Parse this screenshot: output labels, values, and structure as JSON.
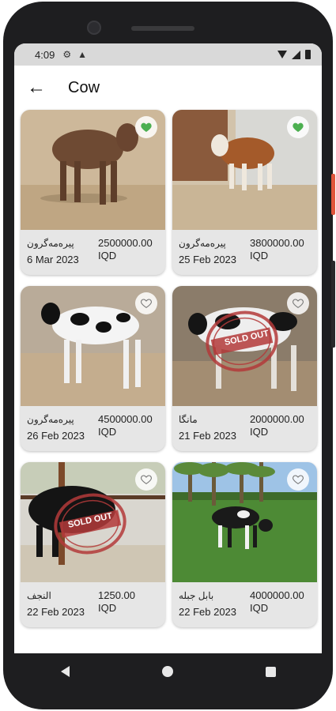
{
  "status_bar": {
    "time": "4:09"
  },
  "app_bar": {
    "title": "Cow"
  },
  "colors": {
    "accent_green": "#4caf50",
    "card_bg": "#e6e6e6",
    "sold_stamp": "#b33a3a"
  },
  "listings": [
    {
      "name": "پیرەمەگرون",
      "date": "6 Mar 2023",
      "price": "2500000.00",
      "currency": "IQD",
      "favorite": true,
      "sold_out": false
    },
    {
      "name": "پیرەمەگرون",
      "date": "25 Feb 2023",
      "price": "3800000.00",
      "currency": "IQD",
      "favorite": true,
      "sold_out": false
    },
    {
      "name": "پیرەمەگرون",
      "date": "26 Feb 2023",
      "price": "4500000.00",
      "currency": "IQD",
      "favorite": false,
      "sold_out": false
    },
    {
      "name": "مانگا",
      "date": "21 Feb 2023",
      "price": "2000000.00",
      "currency": "IQD",
      "favorite": false,
      "sold_out": true,
      "stamp": "SOLD OUT"
    },
    {
      "name": "النجف",
      "date": "22 Feb 2023",
      "price": "1250.00",
      "currency": "IQD",
      "favorite": false,
      "sold_out": true,
      "stamp": "SOLD OUT"
    },
    {
      "name": "بابل جبلە",
      "date": "22 Feb 2023",
      "price": "4000000.00",
      "currency": "IQD",
      "favorite": false,
      "sold_out": false
    }
  ],
  "icons": {
    "back": "arrow-left-icon",
    "favorite": "heart-icon",
    "status": [
      "settings-icon",
      "warning-icon",
      "wifi-icon",
      "signal-icon",
      "battery-icon"
    ],
    "nav": [
      "nav-back-icon",
      "nav-home-icon",
      "nav-recents-icon"
    ]
  }
}
